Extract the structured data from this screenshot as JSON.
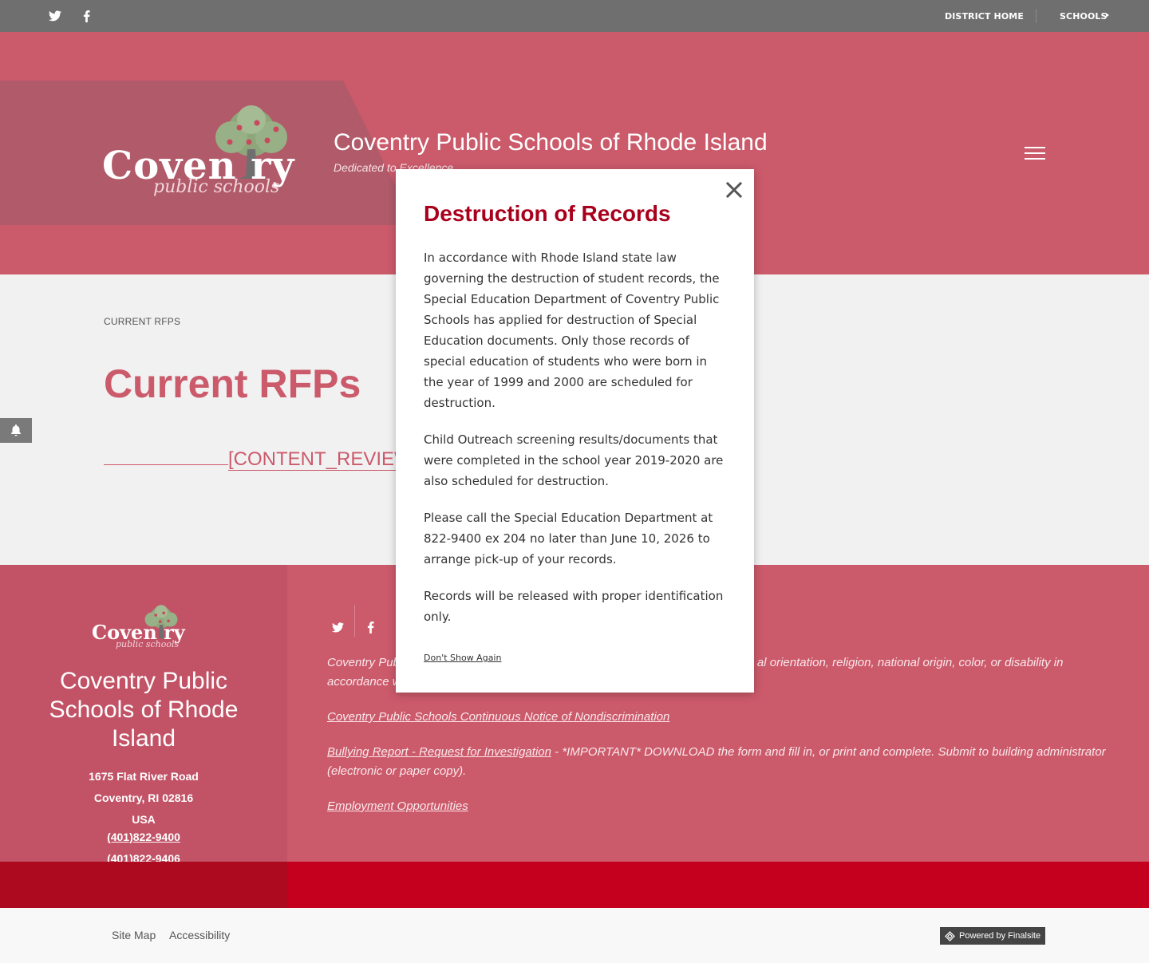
{
  "topbar": {
    "twitter_icon": "twitter-icon",
    "facebook_icon": "facebook-icon",
    "district_home": "DISTRICT HOME",
    "schools": "SCHOOLS"
  },
  "header": {
    "logo_text": "Coven  ry",
    "logo_sub": "public schools",
    "title": "Coventry Public Schools of Rhode Island",
    "tagline": "Dedicated to Excellence"
  },
  "main": {
    "breadcrumb": "CURRENT RFPS",
    "page_title": "Current RFPs",
    "content_link": "[CONTENT_REVIEW"
  },
  "modal": {
    "title": "Destruction of Records",
    "para1": "In accordance with Rhode Island state law governing the destruction of student records, the Special Education Department of Coventry Public Schools has applied for destruction of Special Education documents. Only those records of special education of students who were born in the year of 1999 and 2000 are scheduled for destruction.",
    "para2": "Child Outreach screening results/documents that were completed in the school year 2019-2020 are also scheduled for destruction.",
    "para3": "Please call the Special Education Department at 822-9400 ex 204 no later than June 10, 2026 to arrange pick-up of your records.",
    "para4": "Records will be released with proper identification only.",
    "dont_show": "Don't Show Again"
  },
  "footer": {
    "logo_text": "Coven  ry",
    "logo_sub": "public schools",
    "title": "Coventry Public Schools of Rhode Island",
    "address1": "1675 Flat River Road",
    "address2": "Coventry, RI  02816",
    "address3": "USA",
    "phone": "(401)822-9400",
    "fax": "(401)822-9406",
    "nondiscrim_start": "Coventry Pub",
    "nondiscrim_end": "al orientation, religion, national origin, color, or disability in",
    "nondiscrim_line2": "accordance w",
    "notice_link": "Coventry Public Schools Continuous Notice of Nondiscrimination",
    "bullying_link": "Bullying Report - Request for Investigation",
    "bullying_text": " - *IMPORTANT* DOWNLOAD the form and fill in, or print and complete. Submit to building administrator (electronic or paper copy).",
    "employment_link": "Employment Opportunities"
  },
  "bottom": {
    "sitemap": "Site Map",
    "accessibility": "Accessibility",
    "powered": "Powered by Finalsite"
  }
}
